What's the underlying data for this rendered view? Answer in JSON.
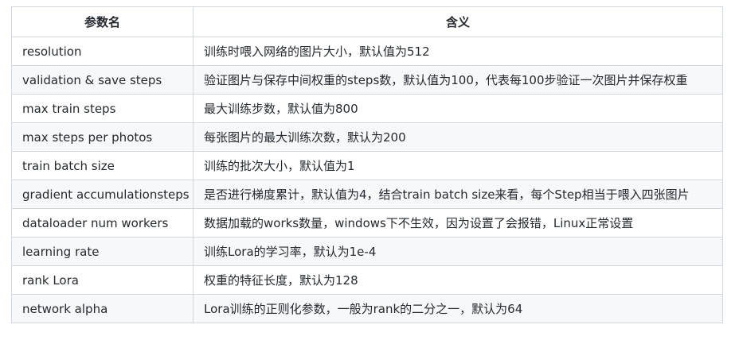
{
  "table": {
    "headers": [
      "参数名",
      "含义"
    ],
    "rows": [
      [
        "resolution",
        "训练时喂入网络的图片大小，默认值为512"
      ],
      [
        "validation & save steps",
        "验证图片与保存中间权重的steps数，默认值为100，代表每100步验证一次图片并保存权重"
      ],
      [
        "max train steps",
        "最大训练步数，默认值为800"
      ],
      [
        "max steps per photos",
        "每张图片的最大训练次数，默认为200"
      ],
      [
        "train batch size",
        "训练的批次大小，默认值为1"
      ],
      [
        "gradient accumulationsteps",
        "是否进行梯度累计，默认值为4，结合train batch size来看，每个Step相当于喂入四张图片"
      ],
      [
        "dataloader num workers",
        "数据加载的works数量，windows下不生效，因为设置了会报错，Linux正常设置"
      ],
      [
        "learning rate",
        "训练Lora的学习率，默认为1e-4"
      ],
      [
        "rank Lora",
        "权重的特征长度，默认为128"
      ],
      [
        "network alpha",
        "Lora训练的正则化参数，一般为rank的二分之一，默认为64"
      ]
    ]
  },
  "colors": {
    "border": "#d0d7de",
    "stripe": "#f6f8fa",
    "text": "#24292f"
  }
}
